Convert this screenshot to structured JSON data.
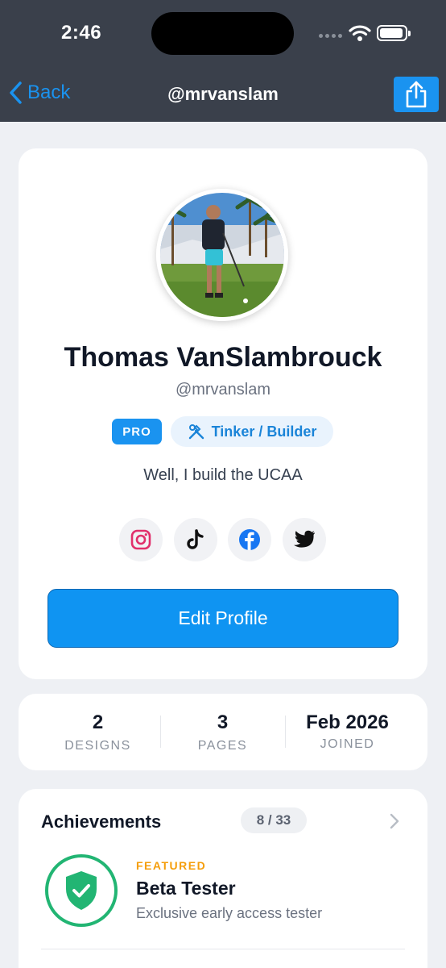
{
  "status_bar": {
    "time": "2:46"
  },
  "nav": {
    "back_label": "Back",
    "title": "@mrvanslam"
  },
  "profile": {
    "name": "Thomas VanSlambrouck",
    "handle": "@mrvanslam",
    "pro_badge": "PRO",
    "role": "Tinker / Builder",
    "bio": "Well, I build the UCAA",
    "socials": [
      "instagram-icon",
      "tiktok-icon",
      "facebook-icon",
      "twitter-icon"
    ],
    "edit_button": "Edit Profile"
  },
  "stats": {
    "designs": {
      "value": "2",
      "label": "DESIGNS"
    },
    "pages": {
      "value": "3",
      "label": "PAGES"
    },
    "joined": {
      "value": "Feb 2026",
      "label": "JOINED"
    }
  },
  "achievements": {
    "title": "Achievements",
    "count": "8 / 33",
    "featured": {
      "tag": "FEATURED",
      "name": "Beta Tester",
      "description": "Exclusive early access tester"
    }
  },
  "colors": {
    "accent": "#1a93f0",
    "header": "#3a404b",
    "success": "#22b573",
    "featured": "#f59e0b"
  }
}
